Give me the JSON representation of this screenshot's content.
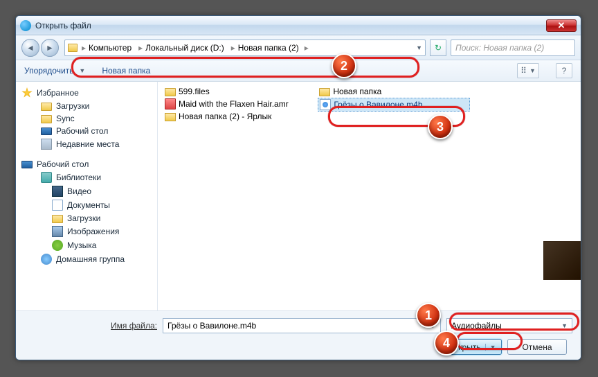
{
  "title": "Открыть файл",
  "breadcrumbs": [
    "Компьютер",
    "Локальный диск (D:)",
    "Новая папка (2)"
  ],
  "search_placeholder": "Поиск: Новая папка (2)",
  "toolbar": {
    "organize": "Упорядочить",
    "newfolder": "Новая папка"
  },
  "sidebar": {
    "fav": "Избранное",
    "downloads": "Загрузки",
    "sync": "Sync",
    "desktop": "Рабочий стол",
    "recent": "Недавние места",
    "desktop2": "Рабочий стол",
    "libs": "Библиотеки",
    "video": "Видео",
    "docs": "Документы",
    "downloads2": "Загрузки",
    "pics": "Изображения",
    "music": "Музыка",
    "homegroup": "Домашняя группа"
  },
  "files": {
    "f1": "599.files",
    "f2": "Maid with the Flaxen Hair.amr",
    "f3": "Новая папка (2) - Ярлык",
    "f4": "Новая папка",
    "f5": "Грёзы о Вавилоне.m4b"
  },
  "filename_label": "Имя файла:",
  "filename_value": "Грёзы о Вавилоне.m4b",
  "filetype": "Аудиофайлы",
  "open_btn": "Открыть",
  "cancel_btn": "Отмена"
}
